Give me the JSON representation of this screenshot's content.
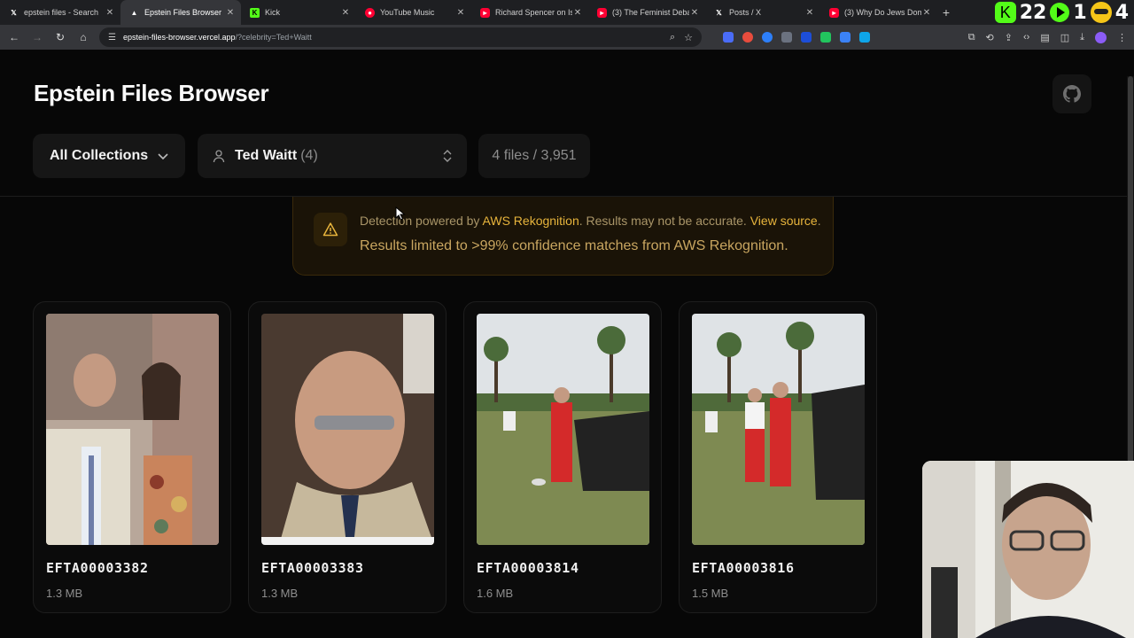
{
  "browser": {
    "tabs": [
      {
        "title": "epstein files - Search",
        "icon": "x-icon",
        "color": "#ffffff",
        "active": false
      },
      {
        "title": "Epstein Files Browser",
        "icon": "vercel-icon",
        "color": "#ffffff",
        "active": true
      },
      {
        "title": "Kick",
        "icon": "kick-icon",
        "color": "#53fc18",
        "active": false
      },
      {
        "title": "YouTube Music",
        "icon": "youtube-music-icon",
        "color": "#ff0033",
        "active": false
      },
      {
        "title": "Richard Spencer on Isra",
        "icon": "youtube-icon",
        "color": "#ff0033",
        "active": false
      },
      {
        "title": "(3) The Feminist Debate",
        "icon": "youtube-icon",
        "color": "#ff0033",
        "active": false
      },
      {
        "title": "Posts / X",
        "icon": "x-icon",
        "color": "#ffffff",
        "active": false
      },
      {
        "title": "(3) Why Do Jews Domi",
        "icon": "youtube-icon",
        "color": "#ff0033",
        "active": false
      }
    ],
    "overlay_text": {
      "kick_count": "22",
      "play_count": "1",
      "face_count": "4"
    },
    "url_host": "epstein-files-browser.vercel.app",
    "url_path": "/?celebrity=Ted+Waitt"
  },
  "page": {
    "title": "Epstein Files Browser",
    "collections_label": "All Collections",
    "celebrity_name": "Ted Waitt",
    "celebrity_count": "(4)",
    "file_count": "4 files / 3,951",
    "notice": {
      "line1_prefix": "Detection powered by ",
      "line1_link": "AWS Rekognition",
      "line1_mid": ". Results may not be accurate. ",
      "line1_source": "View source",
      "line1_end": ".",
      "line2": "Results limited to >99% confidence matches from AWS Rekognition."
    },
    "files": [
      {
        "name": "EFTA00003382",
        "size": "1.3 MB"
      },
      {
        "name": "EFTA00003383",
        "size": "1.3 MB"
      },
      {
        "name": "EFTA00003814",
        "size": "1.6 MB"
      },
      {
        "name": "EFTA00003816",
        "size": "1.5 MB"
      }
    ]
  },
  "colors": {
    "accent": "#e7b43c",
    "background": "#070707",
    "card": "#0b0b0b"
  }
}
